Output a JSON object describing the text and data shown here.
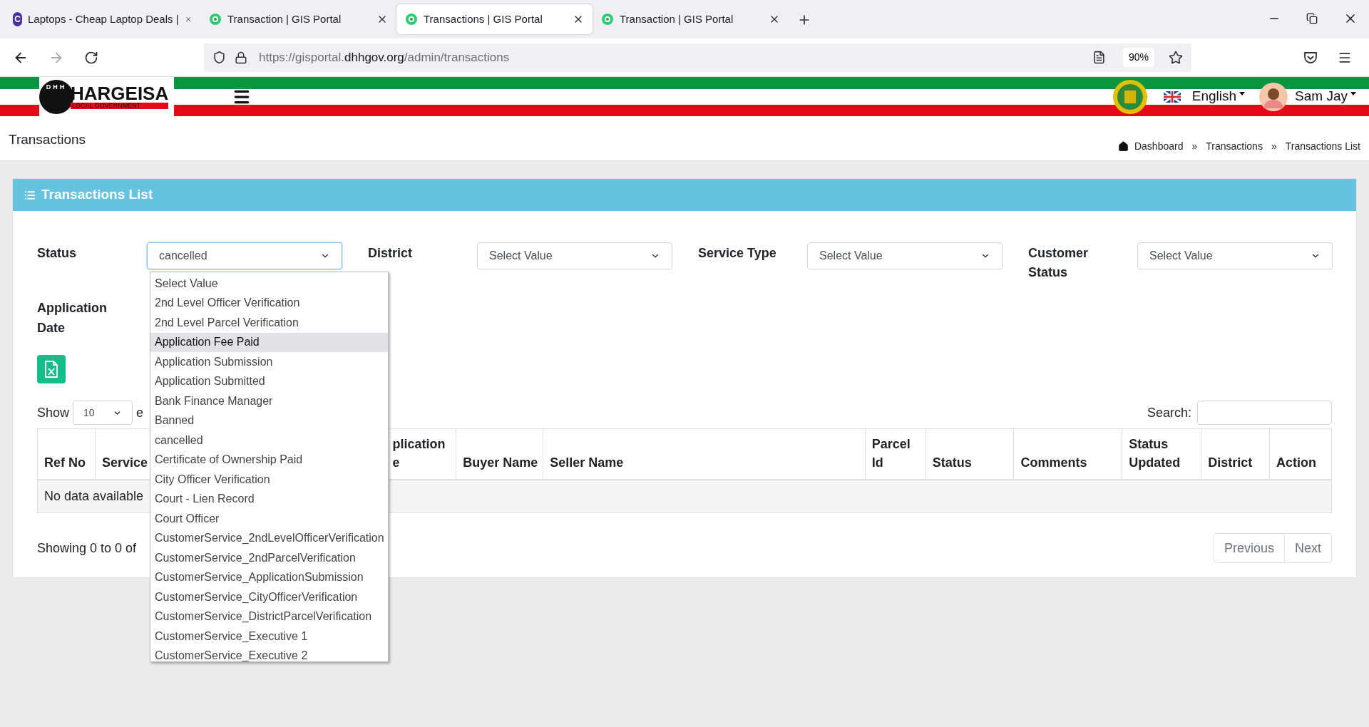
{
  "browser": {
    "tabs": [
      {
        "title": "Laptops - Cheap Laptop Deals |",
        "icon_letter": "C",
        "kind": "letter",
        "selected": false
      },
      {
        "title": "Transaction | GIS Portal",
        "kind": "gis",
        "selected": false
      },
      {
        "title": "Transactions | GIS Portal",
        "kind": "gis",
        "selected": true
      },
      {
        "title": "Transaction | GIS Portal",
        "kind": "gis",
        "selected": false
      }
    ],
    "url": {
      "prefix": "https://gisportal.",
      "domain": "dhhgov.org",
      "path": "/admin/transactions"
    },
    "zoom": "90%"
  },
  "header": {
    "logo_mark": "DHH",
    "logo_title": "HARGEISA",
    "logo_subtitle": "LOCAL GOVERNMENT",
    "language": "English",
    "user": "Sam Jay"
  },
  "page": {
    "title": "Transactions",
    "breadcrumbs": [
      {
        "label": "Dashboard"
      },
      {
        "separator": "»",
        "label": "Transactions"
      },
      {
        "separator": "»",
        "label": "Transactions List"
      }
    ]
  },
  "card": {
    "title": "Transactions List",
    "filters": [
      {
        "label": "Status",
        "value": "cancelled",
        "focused": true
      },
      {
        "label": "District",
        "value": "Select Value",
        "focused": false
      },
      {
        "label": "Service Type",
        "value": "Select Value",
        "focused": false
      },
      {
        "label": "Customer Status",
        "value": "Select Value",
        "focused": false
      }
    ],
    "date_label": "Application Date",
    "show": {
      "label": "Show",
      "value": "10",
      "suffix": "e"
    },
    "search": {
      "label": "Search:"
    },
    "table": {
      "columns": [
        {
          "lines": [
            "Ref No"
          ]
        },
        {
          "lines": [
            "Service"
          ]
        },
        {
          "lines": [
            "plication",
            "e"
          ]
        },
        {
          "lines": [
            "Buyer Name"
          ]
        },
        {
          "lines": [
            "Seller Name"
          ]
        },
        {
          "lines": [
            "Parcel",
            "Id"
          ]
        },
        {
          "lines": [
            "Status"
          ]
        },
        {
          "lines": [
            "Comments"
          ]
        },
        {
          "lines": [
            "Status",
            "Updated"
          ]
        },
        {
          "lines": [
            "District"
          ]
        },
        {
          "lines": [
            "Action"
          ]
        }
      ],
      "empty": "No data available"
    },
    "info": "Showing 0 to 0 of",
    "pagination": [
      {
        "label": "Previous",
        "disabled": true
      },
      {
        "label": "Next",
        "disabled": true
      }
    ],
    "status_options": [
      {
        "label": "Select Value",
        "selected": false
      },
      {
        "label": "2nd Level Officer Verification",
        "selected": false
      },
      {
        "label": "2nd Level Parcel Verification",
        "selected": false
      },
      {
        "label": "Application Fee Paid",
        "selected": true
      },
      {
        "label": "Application Submission",
        "selected": false
      },
      {
        "label": "Application Submitted",
        "selected": false
      },
      {
        "label": "Bank Finance Manager",
        "selected": false
      },
      {
        "label": "Banned",
        "selected": false
      },
      {
        "label": "cancelled",
        "selected": false
      },
      {
        "label": "Certificate of Ownership Paid",
        "selected": false
      },
      {
        "label": "City Officer Verification",
        "selected": false
      },
      {
        "label": "Court - Lien Record",
        "selected": false
      },
      {
        "label": "Court Officer",
        "selected": false
      },
      {
        "label": "CustomerService_2ndLevelOfficerVerification",
        "selected": false
      },
      {
        "label": "CustomerService_2ndParcelVerification",
        "selected": false
      },
      {
        "label": "CustomerService_ApplicationSubmission",
        "selected": false
      },
      {
        "label": "CustomerService_CityOfficerVerification",
        "selected": false
      },
      {
        "label": "CustomerService_DistrictParcelVerification",
        "selected": false
      },
      {
        "label": "CustomerService_Executive 1",
        "selected": false
      },
      {
        "label": "CustomerService_Executive 2",
        "selected": false
      }
    ]
  }
}
